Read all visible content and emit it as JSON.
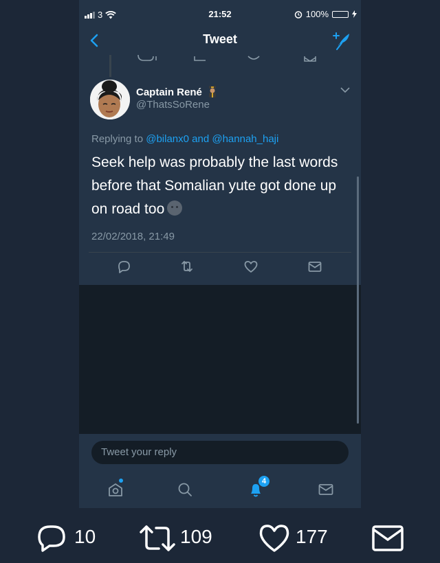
{
  "status_bar": {
    "carrier": "3",
    "time": "21:52",
    "battery": "100%"
  },
  "nav": {
    "title": "Tweet"
  },
  "tweet": {
    "display_name": "Captain René",
    "handle": "@ThatsSoRene",
    "replying_prefix": "Replying to ",
    "replying_user_1": "@bilanx0",
    "replying_and": " and ",
    "replying_user_2": "@hannah_haji",
    "text": "Seek help was probably the last words before that Somalian yute got done up on road too",
    "timestamp": "22/02/2018, 21:49"
  },
  "reply": {
    "placeholder": "Tweet your reply"
  },
  "tab_bar": {
    "notifications_badge": "4"
  },
  "outer_stats": {
    "replies": "10",
    "retweets": "109",
    "likes": "177"
  },
  "colors": {
    "accent": "#1da1f2",
    "background": "#1c2737",
    "card": "#243447",
    "secondary_text": "#8899a6"
  }
}
